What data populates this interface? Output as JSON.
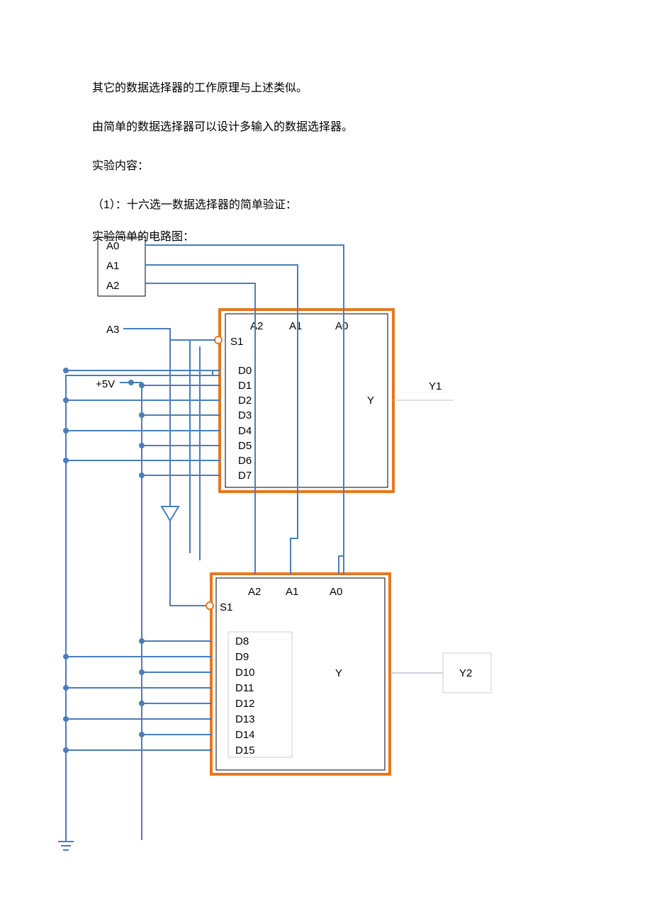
{
  "text": {
    "p1": "其它的数据选择器的工作原理与上述类似。",
    "p2": "由简单的数据选择器可以设计多输入的数据选择器。",
    "p3": "实验内容：",
    "p4": "（1）：十六选一数据选择器的简单验证：",
    "p5": "实验简单的电路图："
  },
  "inputBox": {
    "a0": "A0",
    "a1": "A1",
    "a2": "A2"
  },
  "external": {
    "a3": "A3",
    "vcc": "+5V",
    "y1": "Y1",
    "y2": "Y2"
  },
  "chip1": {
    "sel": {
      "a2": "A2",
      "a1": "A1",
      "a0": "A0"
    },
    "s1": "S1",
    "d": [
      "D0",
      "D1",
      "D2",
      "D3",
      "D4",
      "D5",
      "D6",
      "D7"
    ],
    "y": "Y"
  },
  "chip2": {
    "sel": {
      "a2": "A2",
      "a1": "A1",
      "a0": "A0↵",
      "a0_plain": "A0"
    },
    "s1": "S1",
    "d": [
      "D8",
      "D9",
      "D10",
      "D11",
      "D12",
      "D13",
      "D14",
      "D15"
    ],
    "y": "Y"
  }
}
